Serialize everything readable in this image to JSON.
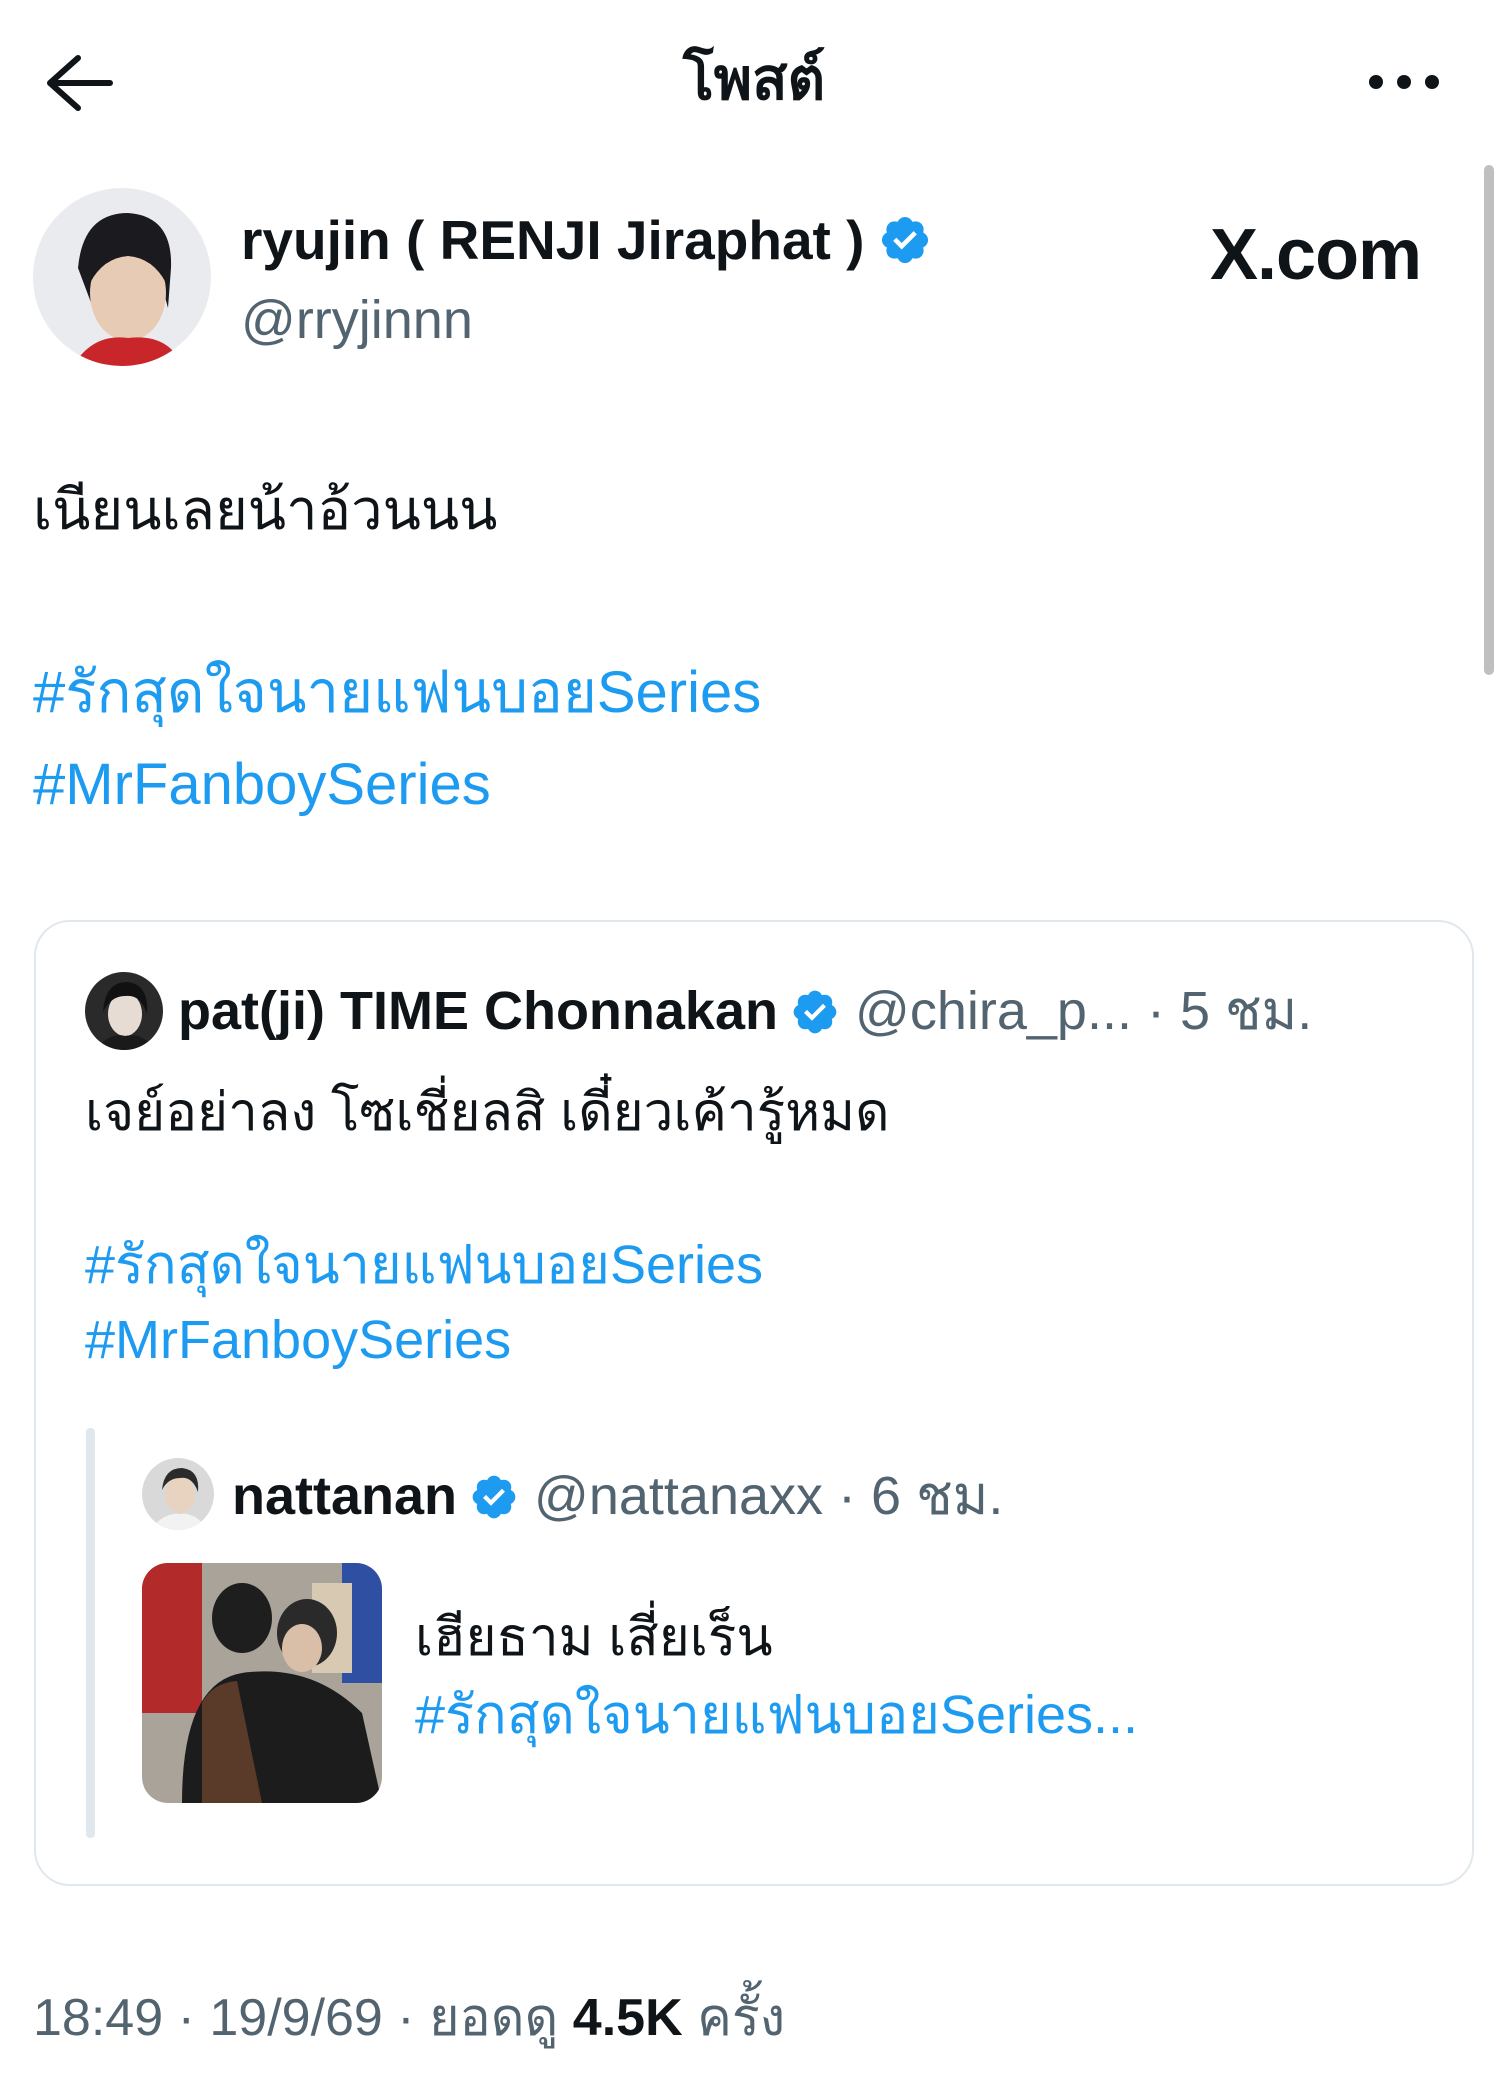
{
  "header": {
    "title": "โพสต์",
    "back_icon": "arrow-left-icon",
    "more_icon": "more-horizontal-icon"
  },
  "watermark": "X.com",
  "author": {
    "display_name": "ryujin ( RENJI Jiraphat )",
    "handle": "@rryjinnn",
    "verified": true
  },
  "tweet": {
    "text": "เนียนเลยน้าอ้วนนน",
    "hashtags": [
      "#รักสุดใจนายแฟนบอยSeries",
      "#MrFanboySeries"
    ]
  },
  "quote": {
    "display_name": "pat(ji) TIME Chonnakan",
    "handle": "@chira_p...",
    "time": "· 5 ชม.",
    "text": "เจย์อย่าลง โซเชี่ยลสิ เดี๋ยวเค้ารู้หมด",
    "hashtags": [
      "#รักสุดใจนายแฟนบอยSeries",
      "#MrFanboySeries"
    ],
    "nested": {
      "display_name": "nattanan",
      "handle": "@nattanaxx",
      "time": "· 6 ชม.",
      "text": "เฮียธาม เสี่ยเร็น",
      "hashtag": "#รักสุดใจนายแฟนบอยSeries..."
    }
  },
  "meta": {
    "time": "18:49",
    "date": "19/9/69",
    "views_label": "ยอดดู",
    "views_count": "4.5K",
    "views_suffix": "ครั้ง"
  },
  "colors": {
    "link": "#1d9bf0",
    "secondary": "#536471",
    "verified": "#1d9bf0"
  }
}
